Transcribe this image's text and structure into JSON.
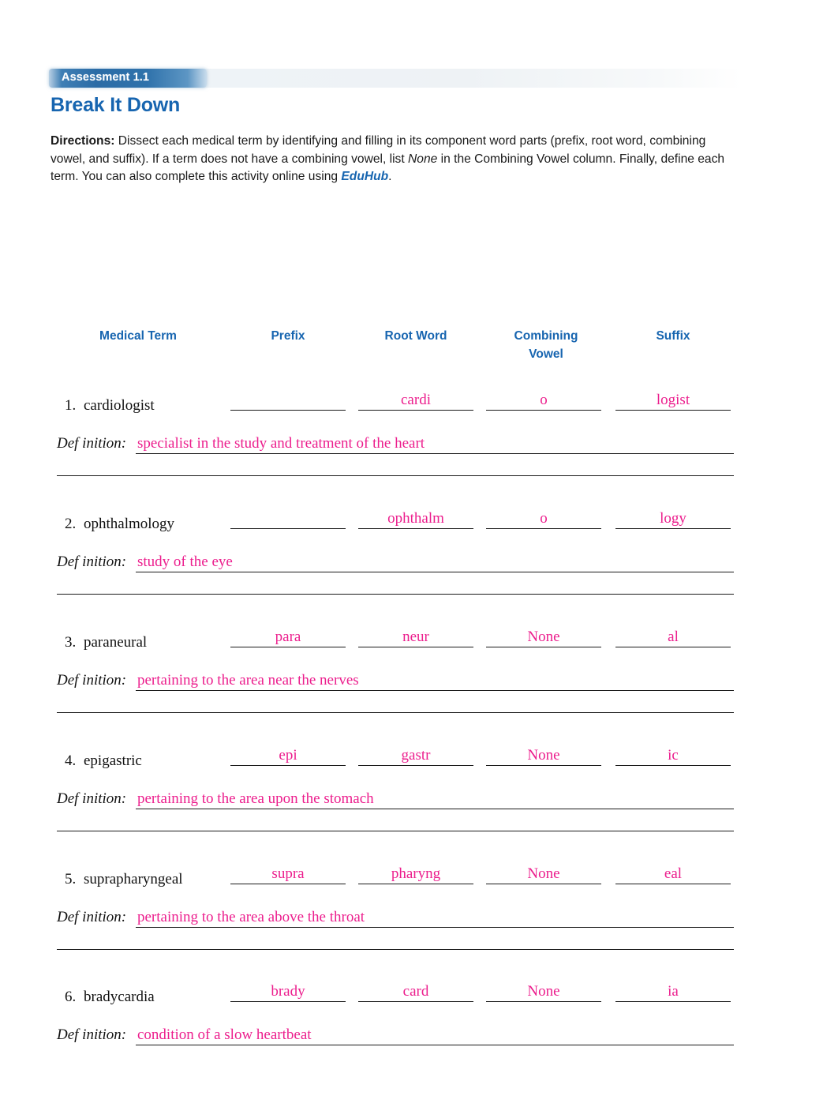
{
  "header": {
    "badge": "Assessment 1.1",
    "title": "Break It Down",
    "badge_color": "#2b6ca6",
    "title_color": "#1765b0"
  },
  "directions": {
    "lead": "Directions:",
    "part1": " Dissect each medical term by identifying and filling in its component word parts (prefix, root word, combining vowel, and suffix). If a term does not have a combining vowel, list ",
    "italic_word": "None",
    "part2": " in the Combining Vowel column. Finally, define each term. You can also complete this activity online using ",
    "link": "EduHub",
    "part3": "."
  },
  "table": {
    "columns": {
      "term": "Medical Term",
      "prefix": "Prefix",
      "root": "Root Word",
      "vowel_line1": "Combining",
      "vowel_line2": "Vowel",
      "suffix": "Suffix"
    },
    "definition_label": "Def inition:",
    "answer_color": "#ec1e8d",
    "rows": [
      {
        "number": "1.",
        "term": "cardiologist",
        "prefix": "",
        "root": "cardi",
        "vowel": "o",
        "suffix": "logist",
        "definition": "specialist in the study and treatment of the heart"
      },
      {
        "number": "2.",
        "term": "ophthalmology",
        "prefix": "",
        "root": "ophthalm",
        "vowel": "o",
        "suffix": "logy",
        "definition": "study of the eye"
      },
      {
        "number": "3.",
        "term": "paraneural",
        "prefix": "para",
        "root": "neur",
        "vowel": "None",
        "suffix": "al",
        "definition": "pertaining to the area near the nerves"
      },
      {
        "number": "4.",
        "term": "epigastric",
        "prefix": "epi",
        "root": "gastr",
        "vowel": "None",
        "suffix": "ic",
        "definition": "pertaining to the area upon the stomach"
      },
      {
        "number": "5.",
        "term": "suprapharyngeal",
        "prefix": "supra",
        "root": "pharyng",
        "vowel": "None",
        "suffix": "eal",
        "definition": "pertaining to the area above the throat"
      },
      {
        "number": "6.",
        "term": "bradycardia",
        "prefix": "brady",
        "root": "card",
        "vowel": "None",
        "suffix": "ia",
        "definition": "condition of a slow heartbeat"
      }
    ]
  }
}
